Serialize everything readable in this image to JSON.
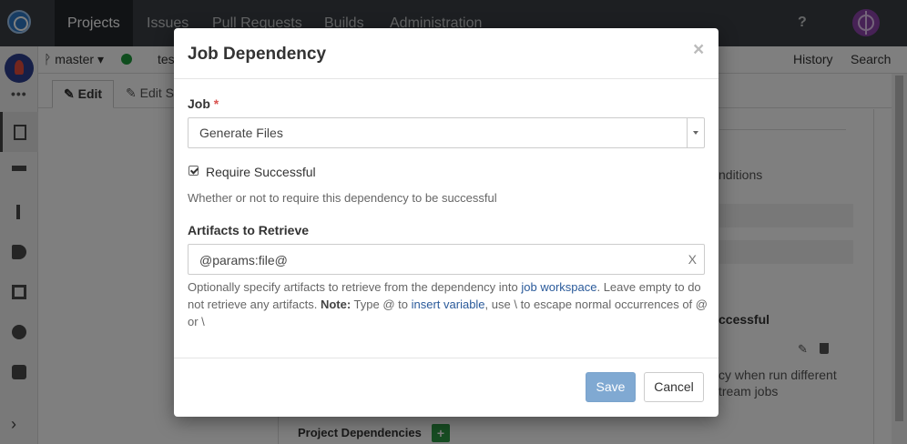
{
  "topbar": {
    "nav": [
      "Projects",
      "Issues",
      "Pull Requests",
      "Builds",
      "Administration"
    ],
    "help_label": "?"
  },
  "subbar": {
    "branch_label": "master",
    "partial_label": "tes",
    "history_label": "History",
    "search_label": "Search"
  },
  "tabs": {
    "edit_label": "Edit",
    "edit_source_label": "Edit S"
  },
  "background": {
    "conditions_text": "nditions",
    "successful_text": "ccessful",
    "run_text": "cy when run different",
    "stream_text": "tream jobs",
    "project_dependencies_label": "Project Dependencies",
    "plus_label": "+"
  },
  "modal": {
    "title": "Job Dependency",
    "close_label": "×",
    "job": {
      "label": "Job",
      "required_mark": "*",
      "selected": "Generate Files"
    },
    "require_successful": {
      "label": "Require Successful",
      "checked": true,
      "help": "Whether or not to require this dependency to be successful"
    },
    "artifacts": {
      "label": "Artifacts to Retrieve",
      "value": "@params:file@",
      "clear_label": "X",
      "help_part1": "Optionally specify artifacts to retrieve from the dependency into ",
      "help_link1": "job workspace",
      "help_part2": ". Leave empty to do not retrieve any artifacts. ",
      "help_note_label": "Note:",
      "help_part3": " Type @ to ",
      "help_link2": "insert variable",
      "help_part4": ", use \\ to escape normal occurrences of @ or \\"
    },
    "save_label": "Save",
    "cancel_label": "Cancel"
  }
}
